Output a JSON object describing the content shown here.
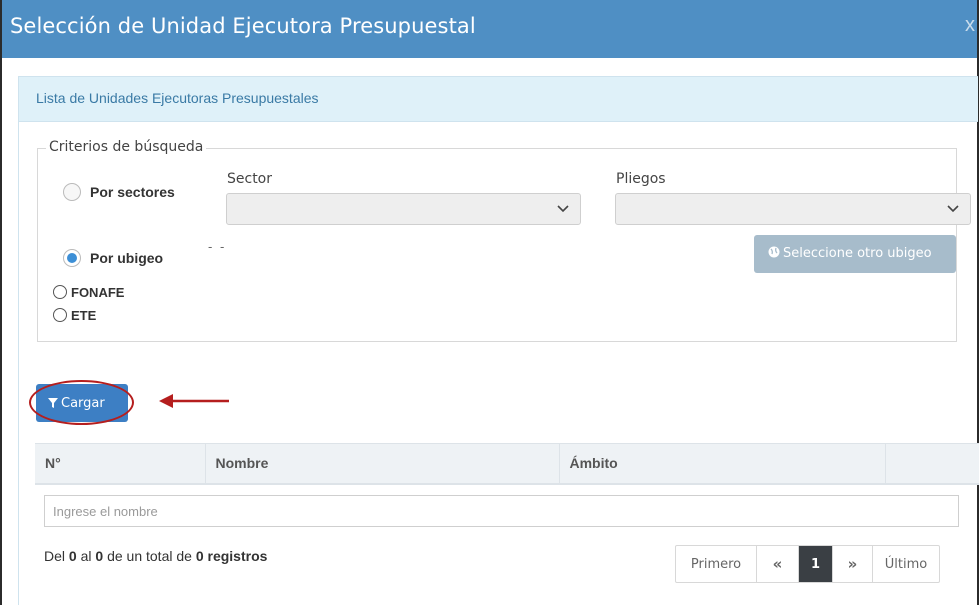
{
  "dialog": {
    "title": "Selección de Unidad Ejecutora Presupuestal",
    "close_label": "x"
  },
  "panel": {
    "heading": "Lista de Unidades Ejecutoras Presupuestales"
  },
  "criteria": {
    "legend": "Criterios de búsqueda",
    "options": {
      "por_sectores": "Por sectores",
      "por_ubigeo": "Por ubigeo",
      "fonafe": "FONAFE",
      "ete": "ETE"
    },
    "selected_option": "por_ubigeo",
    "sector_label": "Sector",
    "sector_value": "",
    "pliegos_label": "Pliegos",
    "pliegos_value": "",
    "ubigeo_text": "- -",
    "ubigeo_button": "Seleccione otro ubigeo"
  },
  "load_button": "Cargar",
  "table": {
    "columns": [
      "N°",
      "Nombre",
      "Ámbito",
      ""
    ],
    "filter_placeholder": "Ingrese el nombre"
  },
  "summary": {
    "prefix": "Del ",
    "from": "0",
    "mid1": " al ",
    "to": "0",
    "mid2": " de un total de ",
    "total": "0 registros"
  },
  "pager": {
    "first": "Primero",
    "prev": "«",
    "current": "1",
    "next": "»",
    "last": "Último"
  },
  "colors": {
    "titlebar": "#4f8fc4",
    "primary_button": "#3d7fc4",
    "disabled_button": "#a7bccb",
    "annotation": "#b51e1e"
  },
  "icons": [
    "close-icon",
    "chevron-down-icon",
    "globe-icon",
    "filter-icon",
    "double-chevron-left-icon",
    "double-chevron-right-icon",
    "arrow-left-icon"
  ]
}
